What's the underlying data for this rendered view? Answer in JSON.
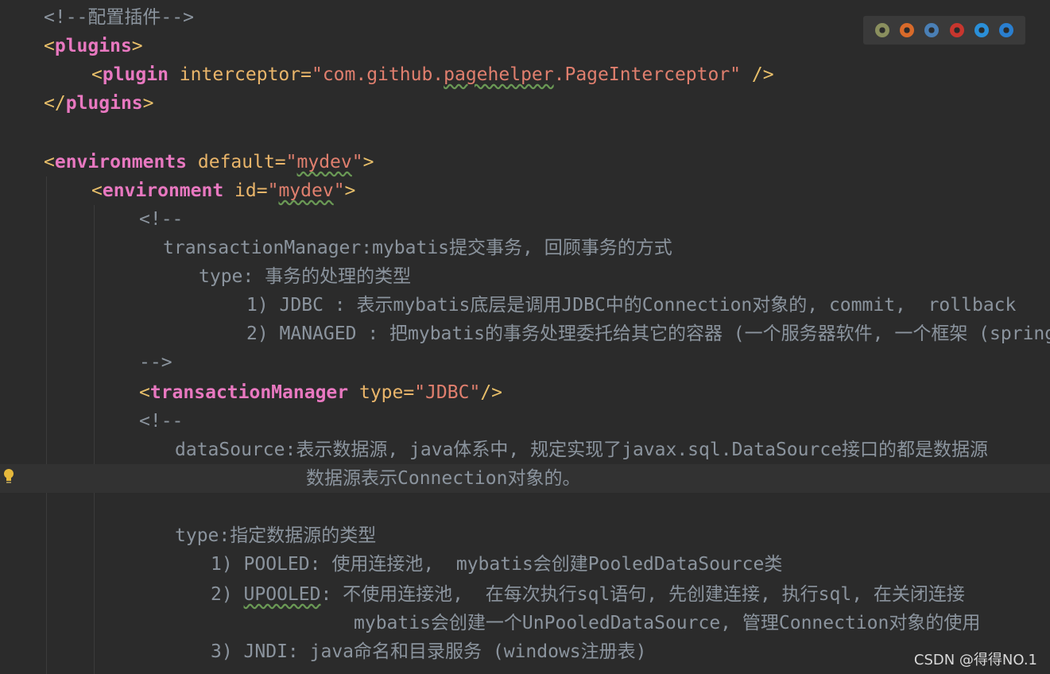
{
  "editor": {
    "lines": [
      {
        "id": "l1",
        "parts": [
          {
            "t": "<!--配置插件-->",
            "c": "cmt"
          }
        ]
      },
      {
        "id": "l2",
        "parts": [
          {
            "t": "<",
            "c": "tag"
          },
          {
            "t": "plugins",
            "c": "name"
          },
          {
            "t": ">",
            "c": "tag"
          }
        ]
      },
      {
        "id": "l3",
        "parts": [
          {
            "t": "<",
            "c": "tag"
          },
          {
            "t": "plugin ",
            "c": "name"
          },
          {
            "t": "interceptor=",
            "c": "attr"
          },
          {
            "t": "\"com.github.",
            "c": "str"
          },
          {
            "t": "pagehelper",
            "c": "str wavy"
          },
          {
            "t": ".PageInterceptor\"",
            "c": "str"
          },
          {
            "t": " />",
            "c": "tag"
          }
        ]
      },
      {
        "id": "l4",
        "parts": [
          {
            "t": "</",
            "c": "tag"
          },
          {
            "t": "plugins",
            "c": "name"
          },
          {
            "t": ">",
            "c": "tag"
          }
        ]
      },
      {
        "id": "l5",
        "parts": []
      },
      {
        "id": "l6",
        "parts": [
          {
            "t": "<",
            "c": "tag"
          },
          {
            "t": "environments ",
            "c": "name"
          },
          {
            "t": "default=",
            "c": "attr"
          },
          {
            "t": "\"",
            "c": "str"
          },
          {
            "t": "mydev",
            "c": "str wavy"
          },
          {
            "t": "\"",
            "c": "str"
          },
          {
            "t": ">",
            "c": "tag"
          }
        ]
      },
      {
        "id": "l7",
        "parts": [
          {
            "t": "<",
            "c": "tag"
          },
          {
            "t": "environment ",
            "c": "name"
          },
          {
            "t": "id=",
            "c": "attr"
          },
          {
            "t": "\"",
            "c": "str"
          },
          {
            "t": "mydev",
            "c": "str wavy"
          },
          {
            "t": "\"",
            "c": "str"
          },
          {
            "t": ">",
            "c": "tag"
          }
        ]
      },
      {
        "id": "l8",
        "parts": [
          {
            "t": "<!--",
            "c": "cmt"
          }
        ]
      },
      {
        "id": "l9",
        "parts": [
          {
            "t": "transactionManager:mybatis提交事务, 回顾事务的方式",
            "c": "cmt"
          }
        ]
      },
      {
        "id": "l10",
        "parts": [
          {
            "t": "type: 事务的处理的类型",
            "c": "cmt"
          }
        ]
      },
      {
        "id": "l11",
        "parts": [
          {
            "t": "1) JDBC : 表示mybatis底层是调用JDBC中的Connection对象的, commit,  rollback",
            "c": "cmt"
          }
        ]
      },
      {
        "id": "l12",
        "parts": [
          {
            "t": "2) MANAGED : 把mybatis的事务处理委托给其它的容器 (一个服务器软件, 一个框架 (spring",
            "c": "cmt"
          }
        ]
      },
      {
        "id": "l13",
        "parts": [
          {
            "t": "-->",
            "c": "cmt"
          }
        ]
      },
      {
        "id": "l14",
        "parts": [
          {
            "t": "<",
            "c": "tag"
          },
          {
            "t": "transactionManager ",
            "c": "name"
          },
          {
            "t": "type=",
            "c": "attr"
          },
          {
            "t": "\"JDBC\"",
            "c": "str"
          },
          {
            "t": "/>",
            "c": "tag"
          }
        ]
      },
      {
        "id": "l15",
        "parts": [
          {
            "t": "<!--",
            "c": "cmt"
          }
        ]
      },
      {
        "id": "l16",
        "parts": [
          {
            "t": "dataSource:表示数据源, java体系中, 规定实现了javax.sql.DataSource接口的都是数据源",
            "c": "cmt"
          }
        ]
      },
      {
        "id": "l17",
        "parts": [
          {
            "t": "数据源表示Connection对象的。",
            "c": "cmt"
          }
        ]
      },
      {
        "id": "l18",
        "parts": []
      },
      {
        "id": "l19",
        "parts": [
          {
            "t": "type:指定数据源的类型",
            "c": "cmt"
          }
        ]
      },
      {
        "id": "l20",
        "parts": [
          {
            "t": "1) POOLED: 使用连接池,  mybatis会创建PooledDataSource类",
            "c": "cmt"
          }
        ]
      },
      {
        "id": "l21",
        "parts": [
          {
            "t": "2) ",
            "c": "cmt"
          },
          {
            "t": "UPOOLED",
            "c": "cmt wavy"
          },
          {
            "t": ": 不使用连接池,  在每次执行sql语句, 先创建连接, 执行sql, 在关闭连接",
            "c": "cmt"
          }
        ]
      },
      {
        "id": "l22",
        "parts": [
          {
            "t": "mybatis会创建一个UnPooledDataSource, 管理Connection对象的使用",
            "c": "cmt"
          }
        ]
      },
      {
        "id": "l23",
        "parts": [
          {
            "t": "3) JNDI: java命名和目录服务 (windows注册表)",
            "c": "cmt"
          }
        ]
      }
    ]
  },
  "browser_icons": [
    {
      "name": "chrome-icon",
      "color": "#8a8f5e"
    },
    {
      "name": "firefox-icon",
      "color": "#d86a2a"
    },
    {
      "name": "safari-icon",
      "color": "#4a7fb5"
    },
    {
      "name": "opera-icon",
      "color": "#c8362e"
    },
    {
      "name": "ie-icon",
      "color": "#2a8fd8"
    },
    {
      "name": "edge-icon",
      "color": "#2a7fd0"
    }
  ],
  "watermark": "CSDN @得得NO.1"
}
